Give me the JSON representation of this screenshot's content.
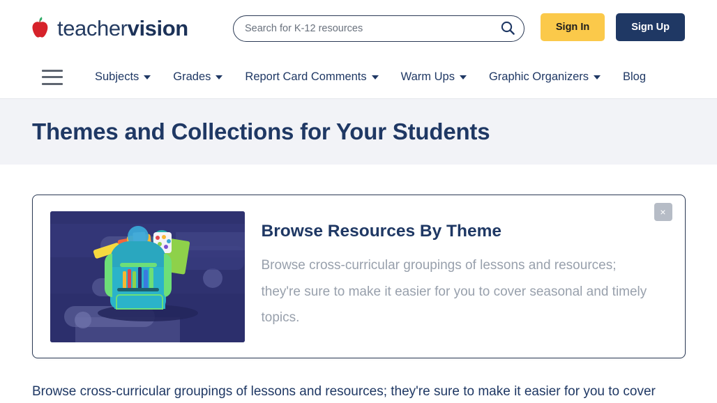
{
  "brand": {
    "name_light": "teacher",
    "name_bold": "vision",
    "logo_icon": "apple-icon",
    "apple_color": "#d6222a",
    "leaf_color": "#2eab66",
    "navy": "#1f3864"
  },
  "search": {
    "placeholder": "Search for K-12 resources",
    "value": "",
    "icon": "search-icon"
  },
  "auth": {
    "sign_in_label": "Sign In",
    "sign_up_label": "Sign Up",
    "sign_in_color": "#fbc94a",
    "sign_up_color": "#1f3864"
  },
  "nav": {
    "menu_icon": "hamburger-icon",
    "items": [
      {
        "label": "Subjects",
        "has_dropdown": true
      },
      {
        "label": "Grades",
        "has_dropdown": true
      },
      {
        "label": "Report Card Comments",
        "has_dropdown": true
      },
      {
        "label": "Warm Ups",
        "has_dropdown": true
      },
      {
        "label": "Graphic Organizers",
        "has_dropdown": true
      },
      {
        "label": "Blog",
        "has_dropdown": false
      }
    ]
  },
  "page": {
    "title": "Themes and Collections for Your Students"
  },
  "promo_card": {
    "title": "Browse Resources By Theme",
    "description": "Browse cross-curricular groupings of lessons and resources; they're sure to make it easier for you to cover seasonal and timely topics.",
    "close_label": "×",
    "image_alt": "backpack-illustration"
  },
  "body": {
    "intro_text": "Browse cross-curricular groupings of lessons and resources; they're sure to make it easier for you to cover"
  }
}
